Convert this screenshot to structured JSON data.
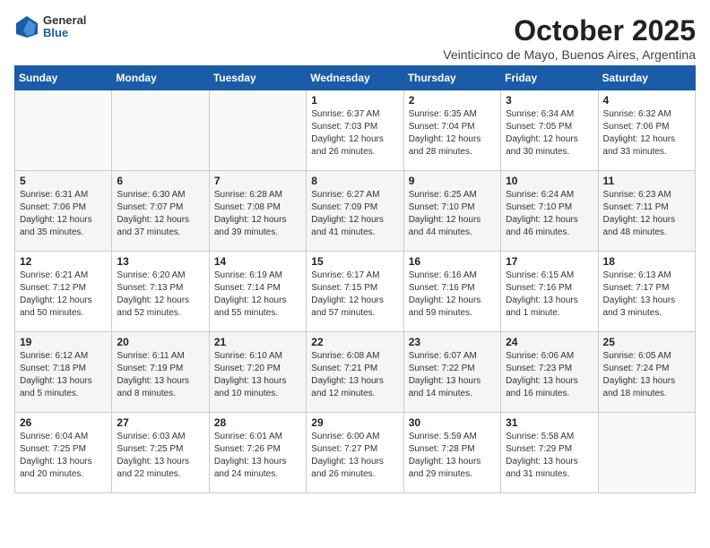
{
  "header": {
    "logo_general": "General",
    "logo_blue": "Blue",
    "month_title": "October 2025",
    "location": "Veinticinco de Mayo, Buenos Aires, Argentina"
  },
  "days_of_week": [
    "Sunday",
    "Monday",
    "Tuesday",
    "Wednesday",
    "Thursday",
    "Friday",
    "Saturday"
  ],
  "weeks": [
    [
      {
        "day": "",
        "info": ""
      },
      {
        "day": "",
        "info": ""
      },
      {
        "day": "",
        "info": ""
      },
      {
        "day": "1",
        "info": "Sunrise: 6:37 AM\nSunset: 7:03 PM\nDaylight: 12 hours\nand 26 minutes."
      },
      {
        "day": "2",
        "info": "Sunrise: 6:35 AM\nSunset: 7:04 PM\nDaylight: 12 hours\nand 28 minutes."
      },
      {
        "day": "3",
        "info": "Sunrise: 6:34 AM\nSunset: 7:05 PM\nDaylight: 12 hours\nand 30 minutes."
      },
      {
        "day": "4",
        "info": "Sunrise: 6:32 AM\nSunset: 7:06 PM\nDaylight: 12 hours\nand 33 minutes."
      }
    ],
    [
      {
        "day": "5",
        "info": "Sunrise: 6:31 AM\nSunset: 7:06 PM\nDaylight: 12 hours\nand 35 minutes."
      },
      {
        "day": "6",
        "info": "Sunrise: 6:30 AM\nSunset: 7:07 PM\nDaylight: 12 hours\nand 37 minutes."
      },
      {
        "day": "7",
        "info": "Sunrise: 6:28 AM\nSunset: 7:08 PM\nDaylight: 12 hours\nand 39 minutes."
      },
      {
        "day": "8",
        "info": "Sunrise: 6:27 AM\nSunset: 7:09 PM\nDaylight: 12 hours\nand 41 minutes."
      },
      {
        "day": "9",
        "info": "Sunrise: 6:25 AM\nSunset: 7:10 PM\nDaylight: 12 hours\nand 44 minutes."
      },
      {
        "day": "10",
        "info": "Sunrise: 6:24 AM\nSunset: 7:10 PM\nDaylight: 12 hours\nand 46 minutes."
      },
      {
        "day": "11",
        "info": "Sunrise: 6:23 AM\nSunset: 7:11 PM\nDaylight: 12 hours\nand 48 minutes."
      }
    ],
    [
      {
        "day": "12",
        "info": "Sunrise: 6:21 AM\nSunset: 7:12 PM\nDaylight: 12 hours\nand 50 minutes."
      },
      {
        "day": "13",
        "info": "Sunrise: 6:20 AM\nSunset: 7:13 PM\nDaylight: 12 hours\nand 52 minutes."
      },
      {
        "day": "14",
        "info": "Sunrise: 6:19 AM\nSunset: 7:14 PM\nDaylight: 12 hours\nand 55 minutes."
      },
      {
        "day": "15",
        "info": "Sunrise: 6:17 AM\nSunset: 7:15 PM\nDaylight: 12 hours\nand 57 minutes."
      },
      {
        "day": "16",
        "info": "Sunrise: 6:16 AM\nSunset: 7:16 PM\nDaylight: 12 hours\nand 59 minutes."
      },
      {
        "day": "17",
        "info": "Sunrise: 6:15 AM\nSunset: 7:16 PM\nDaylight: 13 hours\nand 1 minute."
      },
      {
        "day": "18",
        "info": "Sunrise: 6:13 AM\nSunset: 7:17 PM\nDaylight: 13 hours\nand 3 minutes."
      }
    ],
    [
      {
        "day": "19",
        "info": "Sunrise: 6:12 AM\nSunset: 7:18 PM\nDaylight: 13 hours\nand 5 minutes."
      },
      {
        "day": "20",
        "info": "Sunrise: 6:11 AM\nSunset: 7:19 PM\nDaylight: 13 hours\nand 8 minutes."
      },
      {
        "day": "21",
        "info": "Sunrise: 6:10 AM\nSunset: 7:20 PM\nDaylight: 13 hours\nand 10 minutes."
      },
      {
        "day": "22",
        "info": "Sunrise: 6:08 AM\nSunset: 7:21 PM\nDaylight: 13 hours\nand 12 minutes."
      },
      {
        "day": "23",
        "info": "Sunrise: 6:07 AM\nSunset: 7:22 PM\nDaylight: 13 hours\nand 14 minutes."
      },
      {
        "day": "24",
        "info": "Sunrise: 6:06 AM\nSunset: 7:23 PM\nDaylight: 13 hours\nand 16 minutes."
      },
      {
        "day": "25",
        "info": "Sunrise: 6:05 AM\nSunset: 7:24 PM\nDaylight: 13 hours\nand 18 minutes."
      }
    ],
    [
      {
        "day": "26",
        "info": "Sunrise: 6:04 AM\nSunset: 7:25 PM\nDaylight: 13 hours\nand 20 minutes."
      },
      {
        "day": "27",
        "info": "Sunrise: 6:03 AM\nSunset: 7:25 PM\nDaylight: 13 hours\nand 22 minutes."
      },
      {
        "day": "28",
        "info": "Sunrise: 6:01 AM\nSunset: 7:26 PM\nDaylight: 13 hours\nand 24 minutes."
      },
      {
        "day": "29",
        "info": "Sunrise: 6:00 AM\nSunset: 7:27 PM\nDaylight: 13 hours\nand 26 minutes."
      },
      {
        "day": "30",
        "info": "Sunrise: 5:59 AM\nSunset: 7:28 PM\nDaylight: 13 hours\nand 29 minutes."
      },
      {
        "day": "31",
        "info": "Sunrise: 5:58 AM\nSunset: 7:29 PM\nDaylight: 13 hours\nand 31 minutes."
      },
      {
        "day": "",
        "info": ""
      }
    ]
  ]
}
